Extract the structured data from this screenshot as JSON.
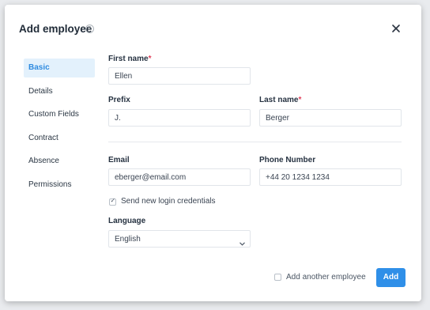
{
  "dialog": {
    "title": "Add employee",
    "help_icon": "question-circle-icon",
    "close_icon": "close-icon"
  },
  "nav": {
    "items": [
      {
        "label": "Basic",
        "active": true
      },
      {
        "label": "Details"
      },
      {
        "label": "Custom Fields"
      },
      {
        "label": "Contract"
      },
      {
        "label": "Absence"
      },
      {
        "label": "Permissions"
      }
    ]
  },
  "form": {
    "first_name": {
      "label": "First name",
      "required_mark": "*",
      "value": "Ellen"
    },
    "prefix": {
      "label": "Prefix",
      "value": "J."
    },
    "last_name": {
      "label": "Last name",
      "required_mark": "*",
      "value": "Berger"
    },
    "email": {
      "label": "Email",
      "value": "eberger@email.com"
    },
    "phone": {
      "label": "Phone Number",
      "value": "+44 20 1234 1234"
    },
    "send_credentials": {
      "label": "Send new login credentials",
      "checked": true
    },
    "language": {
      "label": "Language",
      "value": "English"
    }
  },
  "footer": {
    "add_another": {
      "label": "Add another employee",
      "checked": false
    },
    "add_button": "Add"
  },
  "colors": {
    "primary": "#2f8fe8",
    "nav_active_bg": "#e3f1fc",
    "required": "#e0405a"
  }
}
